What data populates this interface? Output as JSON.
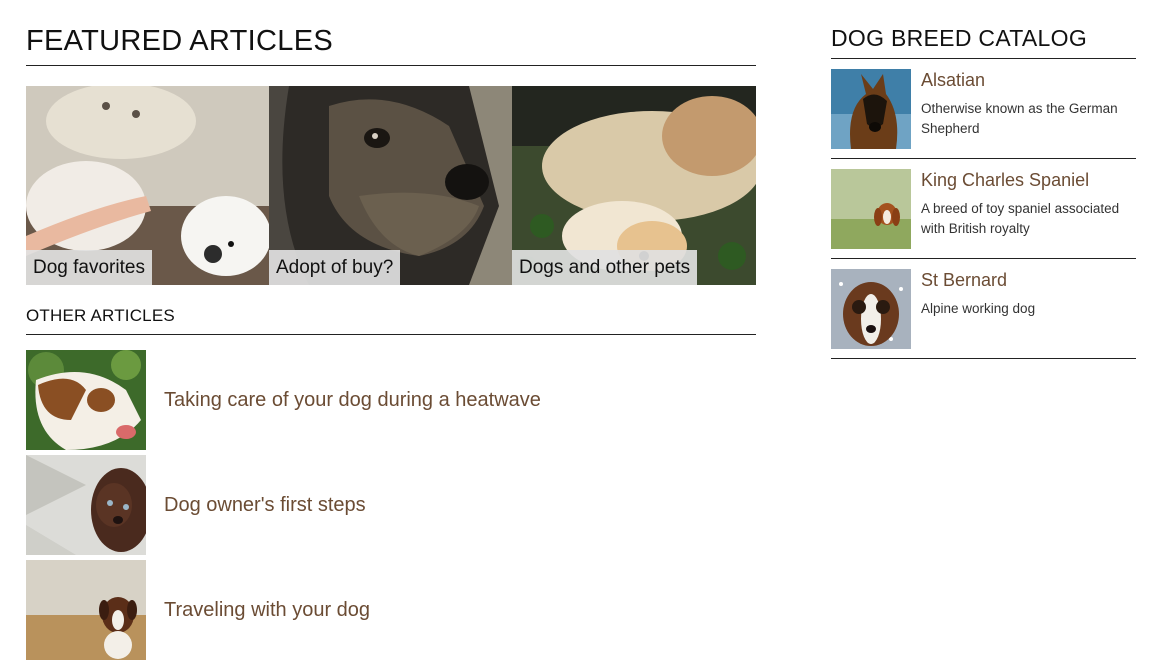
{
  "featured": {
    "heading": "FEATURED ARTICLES",
    "cards": [
      {
        "label": "Dog favorites"
      },
      {
        "label": "Adopt of buy?"
      },
      {
        "label": "Dogs and other pets"
      }
    ]
  },
  "other": {
    "heading": "OTHER ARTICLES",
    "items": [
      {
        "title": "Taking care of your dog during a heatwave"
      },
      {
        "title": "Dog owner's first steps"
      },
      {
        "title": "Traveling with your dog"
      }
    ]
  },
  "catalog": {
    "heading": "DOG BREED CATALOG",
    "breeds": [
      {
        "name": "Alsatian",
        "description": "Otherwise known as the German Shepherd"
      },
      {
        "name": "King Charles Spaniel",
        "description": "A breed of toy spaniel associated with British royalty"
      },
      {
        "name": "St Bernard",
        "description": "Alpine working dog"
      }
    ]
  },
  "colors": {
    "link": "#6b4c34",
    "rule": "#222222",
    "label_bg": "#e1e1e1"
  }
}
